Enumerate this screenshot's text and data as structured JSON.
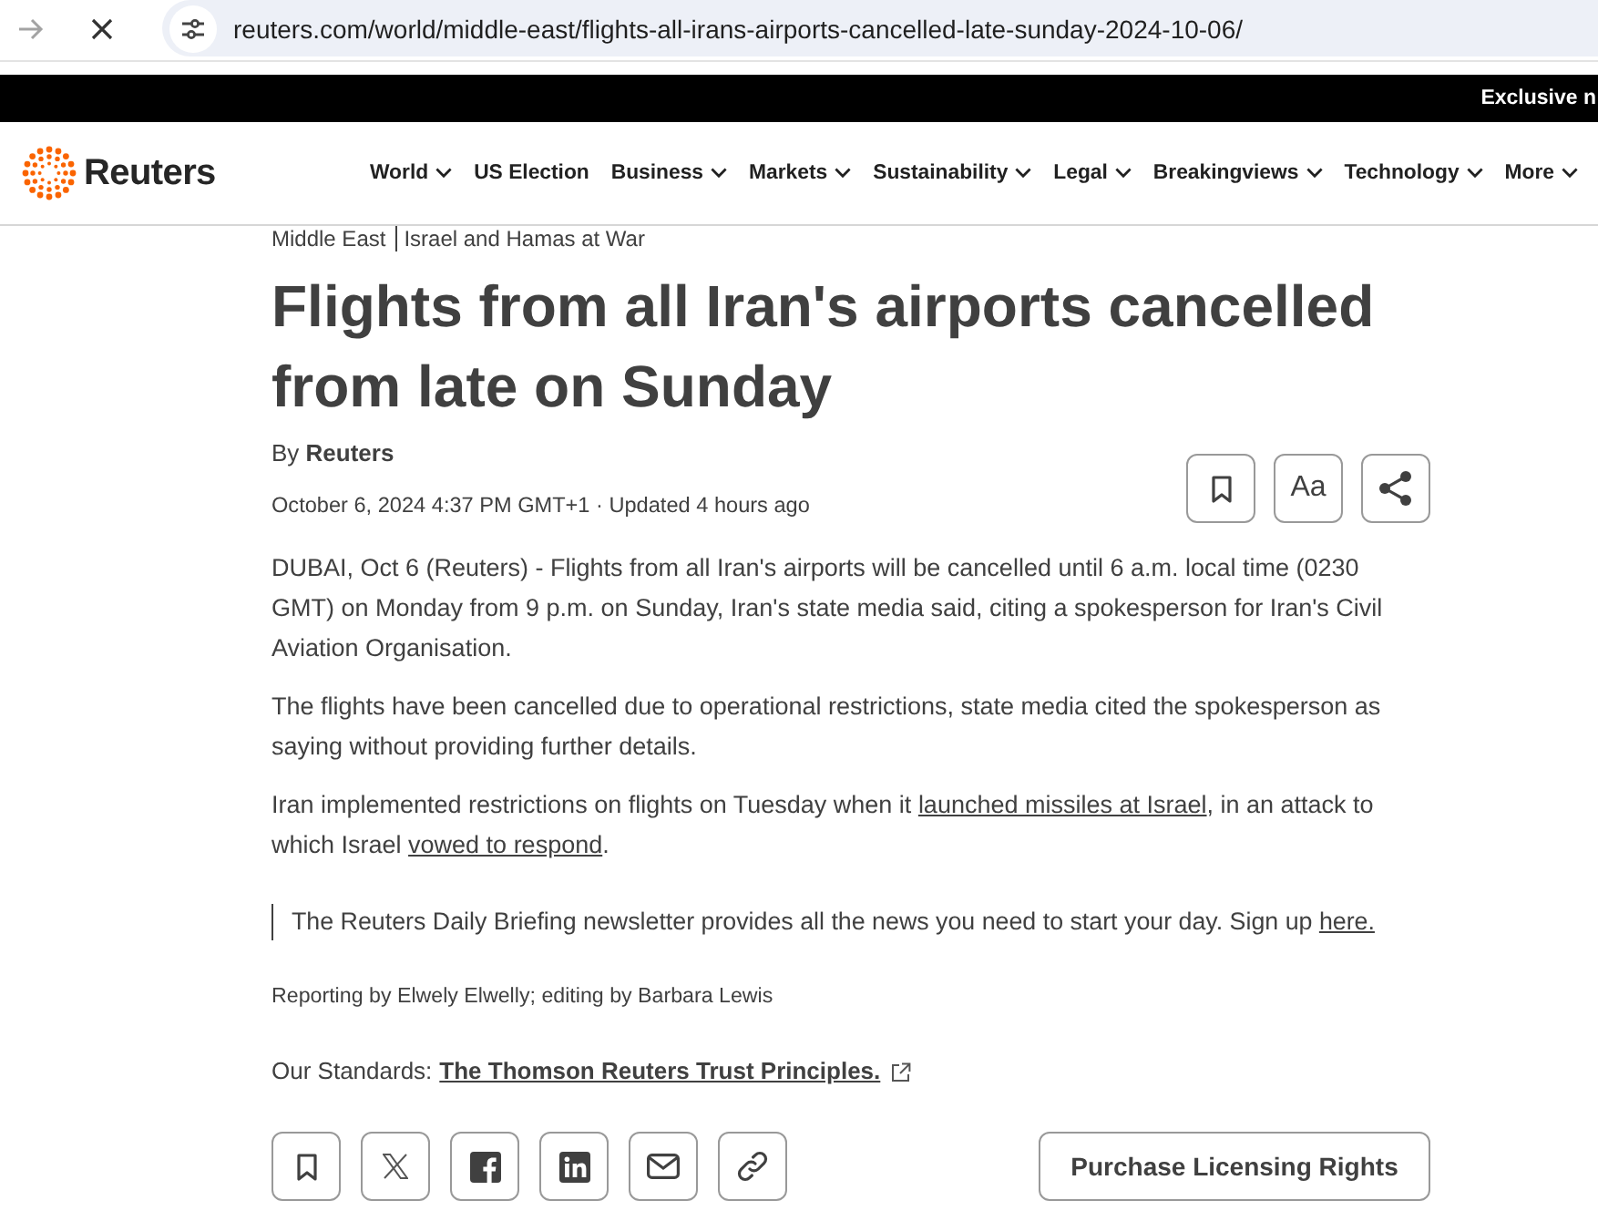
{
  "browser": {
    "forward_enabled": false,
    "loading": true,
    "url": "reuters.com/world/middle-east/flights-all-irans-airports-cancelled-late-sunday-2024-10-06/"
  },
  "ticker": {
    "text": "Exclusive n"
  },
  "header": {
    "logo": "Reuters",
    "nav": [
      {
        "label": "World",
        "dropdown": true
      },
      {
        "label": "US Election",
        "dropdown": false
      },
      {
        "label": "Business",
        "dropdown": true
      },
      {
        "label": "Markets",
        "dropdown": true
      },
      {
        "label": "Sustainability",
        "dropdown": true
      },
      {
        "label": "Legal",
        "dropdown": true
      },
      {
        "label": "Breakingviews",
        "dropdown": true
      },
      {
        "label": "Technology",
        "dropdown": true
      },
      {
        "label": "More",
        "dropdown": true
      }
    ]
  },
  "article": {
    "breadcrumbs": [
      "Middle East",
      "Israel and Hamas at War"
    ],
    "title": "Flights from all Iran's airports cancelled from late on Sunday",
    "byline_prefix": "By",
    "author": "Reuters",
    "dateline": "October 6, 2024 4:37 PM GMT+1 · Updated 4 hours ago",
    "tools": [
      {
        "kind": "bookmark"
      },
      {
        "kind": "text-size",
        "label": "Aa"
      },
      {
        "kind": "share"
      }
    ],
    "paragraphs": [
      [
        {
          "text": "DUBAI, Oct 6 (Reuters) - Flights from all Iran's airports will be cancelled until 6 a.m. local time (0230 GMT) on Monday from 9 p.m. on Sunday, Iran's state media said, citing a spokesperson for Iran's Civil Aviation Organisation."
        }
      ],
      [
        {
          "text": "The flights have been cancelled due to operational restrictions, state media cited the spokesperson as saying without providing further details."
        }
      ],
      [
        {
          "text": "Iran implemented restrictions on flights on Tuesday when it "
        },
        {
          "text": "launched missiles at Israel",
          "link": true
        },
        {
          "text": ", in an attack to which Israel "
        },
        {
          "text": "vowed to respond",
          "link": true
        },
        {
          "text": "."
        }
      ]
    ],
    "newsletter": [
      {
        "text": "The Reuters Daily Briefing newsletter provides all the news you need to start your day. Sign up "
      },
      {
        "text": "here.",
        "link": true
      }
    ],
    "credits": "Reporting by Elwely Elwelly; editing by Barbara Lewis",
    "standards": {
      "label": "Our Standards:",
      "link": "The Thomson Reuters Trust Principles."
    },
    "share": [
      {
        "kind": "bookmark"
      },
      {
        "kind": "x"
      },
      {
        "kind": "facebook"
      },
      {
        "kind": "linkedin"
      },
      {
        "kind": "email"
      },
      {
        "kind": "link"
      }
    ],
    "purchase_button": "Purchase Licensing Rights"
  }
}
